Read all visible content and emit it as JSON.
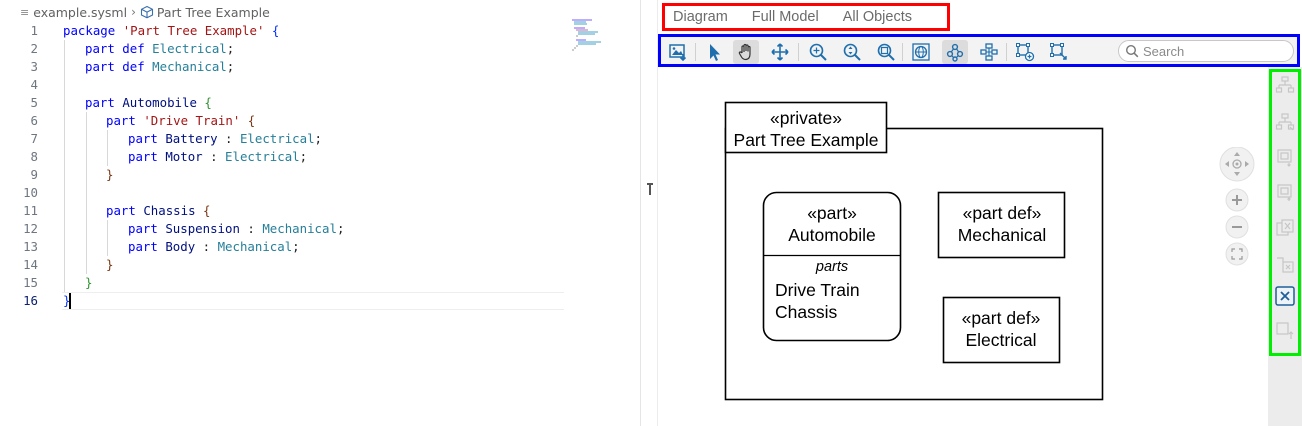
{
  "editor": {
    "breadcrumb": {
      "file": "example.sysml",
      "symbol": "Part Tree Example"
    },
    "active_line": 16,
    "lines": [
      {
        "number": "1",
        "text": "package 'Part Tree Example' {"
      },
      {
        "number": "2",
        "text": "part def Electrical;"
      },
      {
        "number": "3",
        "text": "part def Mechanical;"
      },
      {
        "number": "4",
        "text": ""
      },
      {
        "number": "5",
        "text": "part Automobile {"
      },
      {
        "number": "6",
        "text": "part 'Drive Train' {"
      },
      {
        "number": "7",
        "text": "part Battery : Electrical;"
      },
      {
        "number": "8",
        "text": "part Motor : Electrical;"
      },
      {
        "number": "9",
        "text": "}"
      },
      {
        "number": "10",
        "text": ""
      },
      {
        "number": "11",
        "text": "part Chassis {"
      },
      {
        "number": "12",
        "text": "part Suspension : Mechanical;"
      },
      {
        "number": "13",
        "text": "part Body : Mechanical;"
      },
      {
        "number": "14",
        "text": "}"
      },
      {
        "number": "15",
        "text": "}"
      },
      {
        "number": "16",
        "text": "}"
      }
    ]
  },
  "diagram_panel": {
    "tabs": [
      {
        "label": "Diagram",
        "active": true
      },
      {
        "label": "Full Model",
        "active": false
      },
      {
        "label": "All Objects",
        "active": false
      }
    ],
    "toolbar": {
      "buttons": [
        {
          "icon": "export-image-icon"
        },
        {
          "icon": "select-pointer-icon"
        },
        {
          "icon": "pan-hand-icon",
          "active": true
        },
        {
          "icon": "move-icon"
        },
        {
          "icon": "zoom-fit-icon"
        },
        {
          "icon": "zoom-vertical-icon"
        },
        {
          "icon": "zoom-selection-icon"
        },
        {
          "icon": "globe-icon"
        },
        {
          "icon": "layout-icon"
        },
        {
          "icon": "hierarchy-icon"
        },
        {
          "icon": "add-node-icon"
        },
        {
          "icon": "connect-nodes-icon"
        }
      ],
      "search_placeholder": "Search"
    },
    "diagram": {
      "package": {
        "stereotype": "«private»",
        "name": "Part Tree Example"
      },
      "automobile": {
        "stereotype": "«part»",
        "name": "Automobile",
        "compartment": "parts",
        "members": [
          "Drive Train",
          "Chassis"
        ]
      },
      "mechanical": {
        "stereotype": "«part def»",
        "name": "Mechanical"
      },
      "electrical": {
        "stereotype": "«part def»",
        "name": "Electrical"
      }
    },
    "nav_controls": [
      "pan-icon",
      "zoom-in-icon",
      "zoom-out-icon",
      "fit-screen-icon"
    ],
    "side_toolbar": [
      "expand-tree-icon",
      "collapse-tree-icon",
      "show-compartment-icon",
      "hide-compartment-icon",
      "remove-compartment-icon",
      "remove-relation-icon",
      "close-x-icon",
      "resize-icon"
    ],
    "colors": {
      "tabs_highlight": "#ff0000",
      "toolbar_highlight": "#0000ff",
      "side_highlight": "#00ee00"
    }
  }
}
